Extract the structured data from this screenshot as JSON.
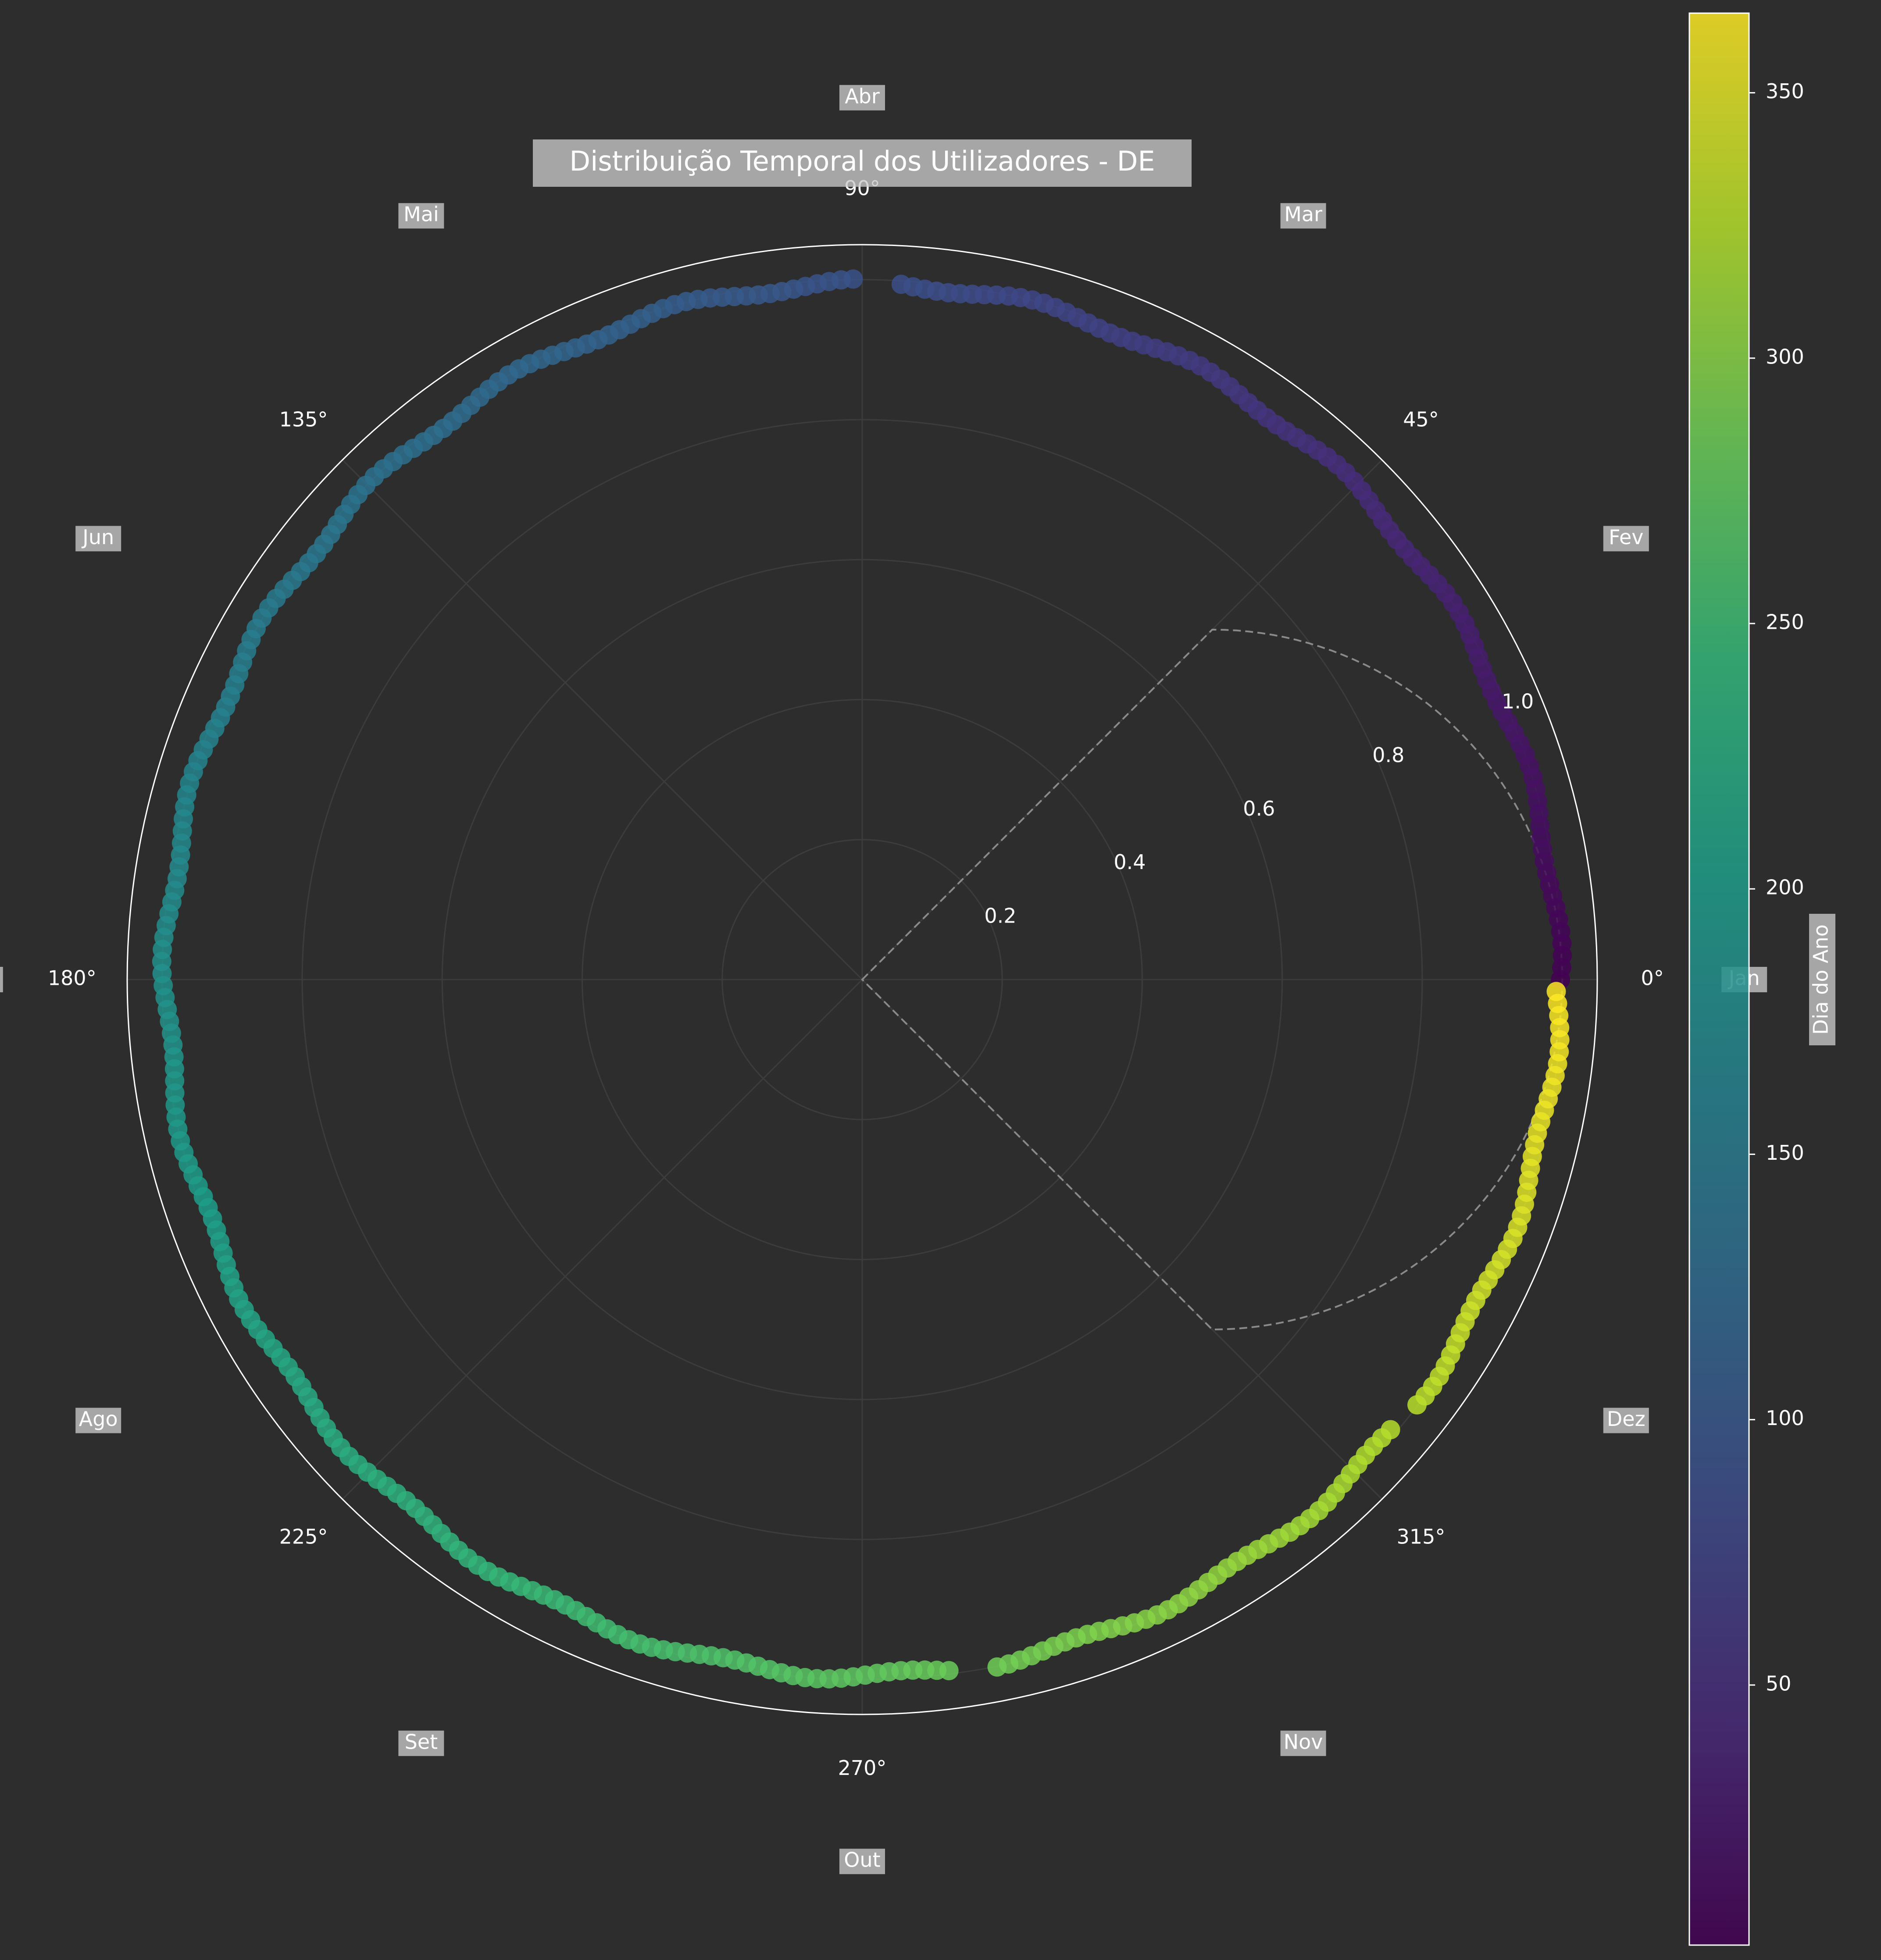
{
  "chart_data": {
    "type": "scatter",
    "projection": "polar",
    "title": "Distribuição Temporal dos Utilizadores - DE",
    "angle_ticks": [
      "0°",
      "45°",
      "90°",
      "135°",
      "180°",
      "225°",
      "270°",
      "315°"
    ],
    "angle_tick_values_deg": [
      0,
      45,
      90,
      135,
      180,
      225,
      270,
      315
    ],
    "radial_ticks": [
      "0.2",
      "0.4",
      "0.6",
      "0.8",
      "1.0"
    ],
    "radial_tick_values": [
      0.2,
      0.4,
      0.6,
      0.8,
      1.0
    ],
    "rlim": [
      0,
      1.05
    ],
    "grid": true,
    "month_labels": [
      "Jan",
      "Fev",
      "Mar",
      "Abr",
      "Mai",
      "Jun",
      "Jul",
      "Ago",
      "Set",
      "Out",
      "Nov",
      "Dez"
    ],
    "month_label_angles_deg": [
      0,
      30,
      60,
      90,
      120,
      150,
      180,
      210,
      240,
      270,
      300,
      330
    ],
    "points": {
      "x_label": "day of year",
      "day_range": [
        1,
        365
      ],
      "radius": 1.0,
      "gaps_days": [
        [
          90,
          92
        ],
        [
          283,
          285
        ],
        [
          326,
          327
        ]
      ],
      "color_by": "day of year"
    },
    "dashed_curve": {
      "description": "r = cos(theta) reference curve",
      "theta_range_deg": [
        -45,
        45
      ]
    },
    "colorbar": {
      "label": "Dia do Ano",
      "range": [
        1,
        365
      ],
      "ticks": [
        "50",
        "100",
        "150",
        "200",
        "250",
        "300",
        "350"
      ],
      "tick_values": [
        50,
        100,
        150,
        200,
        250,
        300,
        350
      ],
      "colormap": "viridis"
    },
    "colors": {
      "background": "#2d2d2d",
      "text": "#ffffff",
      "grid": "#3c3c3c",
      "outer_circle": "#ffffff",
      "dashed": "#8a8a8a"
    }
  }
}
